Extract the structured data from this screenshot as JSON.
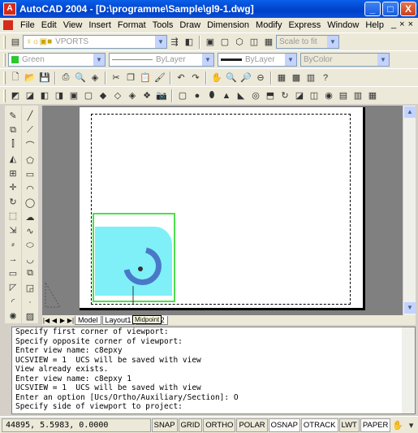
{
  "window": {
    "title": "AutoCAD 2004 - [D:\\programme\\Sample\\gl9-1.dwg]",
    "app_logo": "A",
    "btn_min": "_",
    "btn_max": "□",
    "btn_close": "X"
  },
  "menu": {
    "items": [
      "File",
      "Edit",
      "View",
      "Insert",
      "Format",
      "Tools",
      "Draw",
      "Dimension",
      "Modify",
      "Express",
      "Window",
      "Help"
    ],
    "mdi": [
      "_",
      "×",
      "×"
    ]
  },
  "toolbar": {
    "layer_combo": "VPORTS",
    "scale_combo": "Scale to fit",
    "color_combo": "Green",
    "linetype_combo": "ByLayer",
    "lineweight_combo": "ByLayer",
    "plotstyle_combo": "ByColor"
  },
  "drawing": {
    "tooltip": "Midpoint",
    "tabs": [
      "Model",
      "Layout1",
      "Layout2"
    ]
  },
  "command": {
    "lines": [
      "Specify first corner of viewport:",
      "Specify opposite corner of viewport:",
      "Enter view name: c8epxy",
      "UCSVIEW = 1  UCS will be saved with view",
      "View already exists.",
      "Enter view name: c8epxy 1",
      "UCSVIEW = 1  UCS will be saved with view",
      "Enter an option [Ucs/Ortho/Auxiliary/Section]: O",
      "",
      "Specify side of viewport to project:"
    ]
  },
  "status": {
    "coords": "44895, 5.5983, 0.0000",
    "buttons": [
      "SNAP",
      "GRID",
      "ORTHO",
      "POLAR",
      "OSNAP",
      "OTRACK",
      "LWT",
      "PAPER"
    ]
  },
  "colors": {
    "titlebar": "#0a4fd8",
    "viewport_border": "#4ce04c",
    "fill_cyan": "#7ff0f8",
    "arc": "#4a78c8"
  }
}
